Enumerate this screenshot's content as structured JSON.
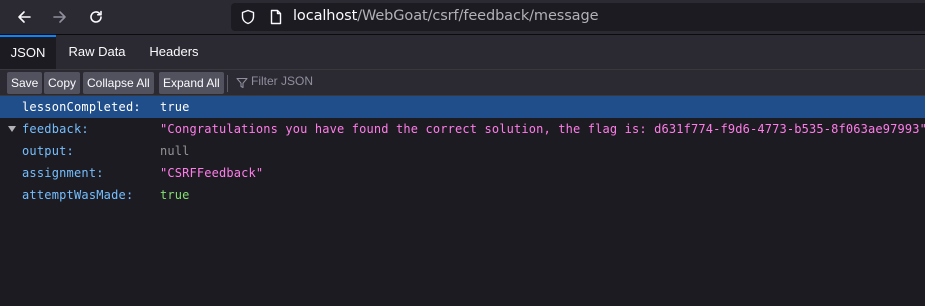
{
  "browser": {
    "url_host": "localhost",
    "url_path": "/WebGoat/csrf/feedback/message"
  },
  "viewer": {
    "tabs": [
      "JSON",
      "Raw Data",
      "Headers"
    ],
    "active_tab": "JSON",
    "toolbar": {
      "save": "Save",
      "copy": "Copy",
      "collapse_all": "Collapse All",
      "expand_all": "Expand All",
      "filter_placeholder": "Filter JSON"
    }
  },
  "json": {
    "rows": [
      {
        "key": "lessonCompleted:",
        "value": "true",
        "type": "bool",
        "selected": true
      },
      {
        "key": "feedback:",
        "value": "\"Congratulations you have found the correct solution, the flag is: d631f774-f9d6-4773-b535-8f063ae97993\"",
        "type": "string",
        "expandable": true
      },
      {
        "key": "output:",
        "value": "null",
        "type": "null"
      },
      {
        "key": "assignment:",
        "value": "\"CSRFFeedback\"",
        "type": "string"
      },
      {
        "key": "attemptWasMade:",
        "value": "true",
        "type": "bool"
      }
    ]
  },
  "colors": {
    "string": "#ff7de9",
    "bool": "#86de74",
    "null": "#939395",
    "key": "#75bfff",
    "selection": "#204e8a"
  }
}
